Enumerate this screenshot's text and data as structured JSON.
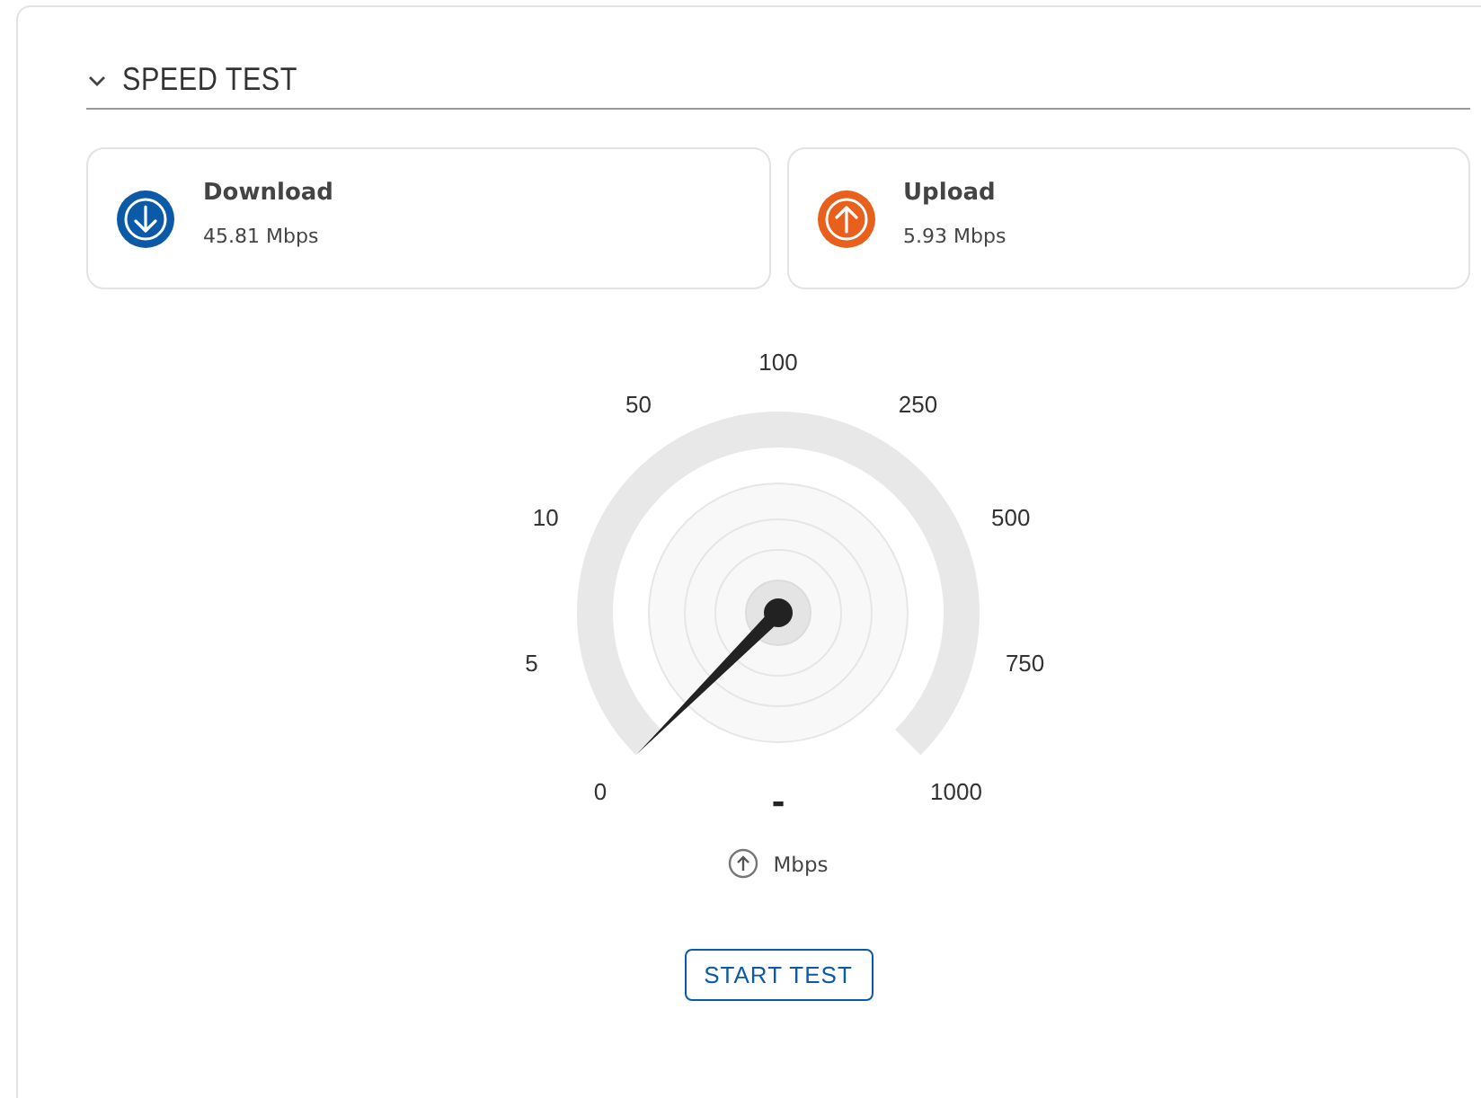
{
  "section": {
    "title": "SPEED TEST",
    "expanded": true
  },
  "results": [
    {
      "kind": "download",
      "label": "Download",
      "value": "45.81 Mbps",
      "color": "#0b5aa8"
    },
    {
      "kind": "upload",
      "label": "Upload",
      "value": "5.93 Mbps",
      "color": "#e8601c"
    }
  ],
  "gauge": {
    "scale": [
      "0",
      "5",
      "10",
      "50",
      "100",
      "250",
      "500",
      "750",
      "1000"
    ],
    "reading": "-",
    "unit": "Mbps"
  },
  "button": "START TEST"
}
